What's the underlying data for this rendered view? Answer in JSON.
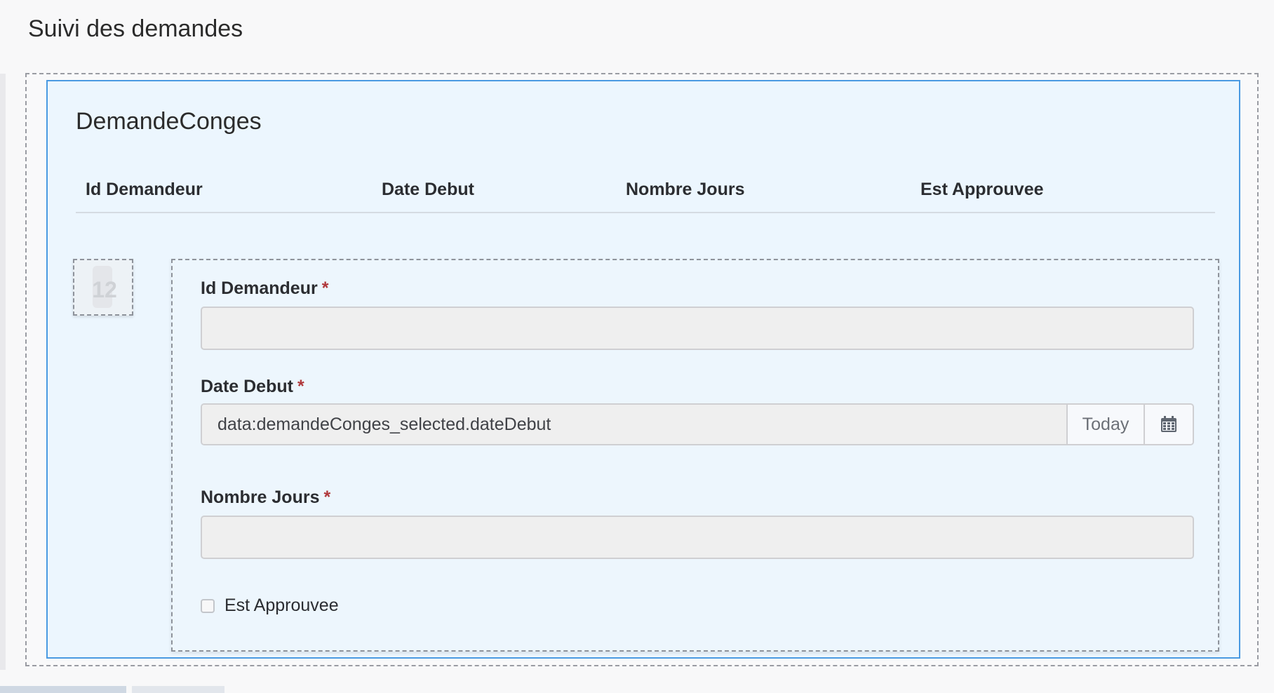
{
  "page": {
    "title": "Suivi des demandes"
  },
  "panel": {
    "title": "DemandeConges",
    "columns": [
      "Id Demandeur",
      "Date Debut",
      "Nombre Jours",
      "Est Approuvee"
    ]
  },
  "row": {
    "number": "12"
  },
  "form": {
    "id_demandeur": {
      "label": "Id Demandeur",
      "required_mark": "*",
      "value": ""
    },
    "date_debut": {
      "label": "Date Debut",
      "required_mark": "*",
      "value": "data:demandeConges_selected.dateDebut",
      "today_label": "Today",
      "icon": "calendar-icon"
    },
    "nombre_jours": {
      "label": "Nombre Jours",
      "required_mark": "*",
      "value": ""
    },
    "est_approuvee": {
      "label": "Est Approuvee",
      "checked": false
    }
  },
  "colors": {
    "panel_border": "#4a9ae2",
    "panel_background": "#ecf6fe",
    "required": "#b0383b"
  }
}
